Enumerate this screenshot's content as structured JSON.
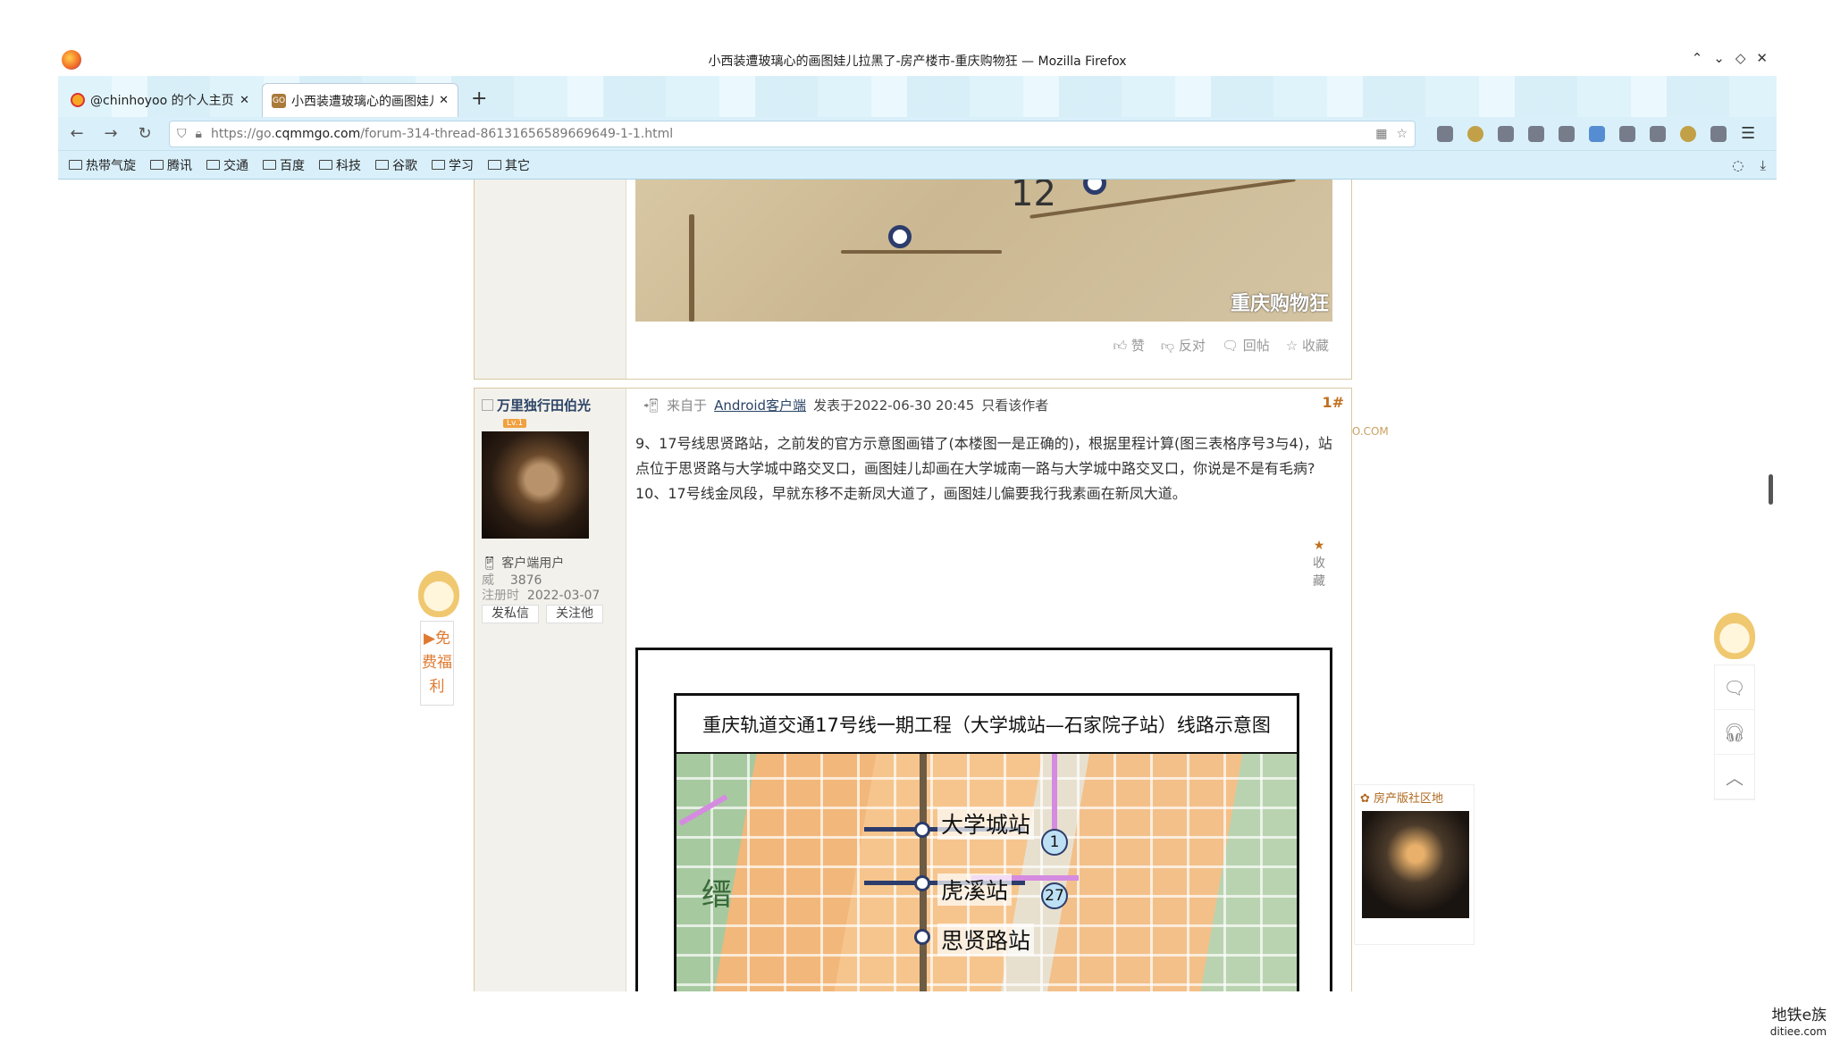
{
  "window": {
    "title": "小西装遭玻璃心的画图娃儿拉黑了-房产楼市-重庆购物狂 — Mozilla Firefox",
    "controls": [
      "⌃",
      "⌄",
      "◇",
      "✕"
    ]
  },
  "tabs": [
    {
      "title": "@chinhoyoo 的个人主页 - 微",
      "close": "✕"
    },
    {
      "title": "小西装遭玻璃心的画图娃儿拉黑了",
      "close": "✕",
      "favicon_text": "GO"
    }
  ],
  "new_tab": "+",
  "nav": {
    "back": "←",
    "forward": "→",
    "reload": "↻",
    "url_prefix": "https://go.",
    "url_domain": "cqmmgo.com",
    "url_path": "/forum-314-thread-86131656589669649-1-1.html"
  },
  "bookmarks": [
    "热带气旋",
    "腾讯",
    "交通",
    "百度",
    "科技",
    "谷歌",
    "学习",
    "其它"
  ],
  "post1": {
    "map_number": "12",
    "watermark": "重庆购物狂",
    "actions": [
      "赞",
      "反对",
      "回帖",
      "收藏"
    ]
  },
  "site_mark": "CQMMGO.COM",
  "post2": {
    "author": "万里独行田伯光",
    "level_badge": "Lv.1",
    "user_type": "客户端用户",
    "stat_wei_label": "威",
    "stat_wei_value": "3876",
    "stat_reg_label": "注册时",
    "stat_reg_value": "2022-03-07",
    "btn_msg": "发私信",
    "btn_follow": "关注他",
    "meta_from": "来自于",
    "meta_client": "Android客户端",
    "meta_posted": "发表于2022-06-30 20:45",
    "meta_only": "只看该作者",
    "floor": "1#",
    "content_line1": "9、17号线思贤路站，之前发的官方示意图画错了(本楼图一是正确的)，根据里程计算(图三表格序号3与4)，站点位于思贤路与大学城中路交叉口，画图娃儿却画在大学城南一路与大学城中路交叉口，你说是不是有毛病?",
    "content_line2": "10、17号线金凤段，早就东移不走新凤大道了，画图娃儿偏要我行我素画在新凤大道。",
    "image_title": "重庆轨道交通17号线一期工程（大学城站—石家院子站）线路示意图",
    "stations": [
      "大学城站",
      "虎溪站",
      "思贤路站"
    ],
    "line_circles": [
      "1",
      "27"
    ],
    "map_char": "缙",
    "fav_label": "收藏"
  },
  "left_float": {
    "text": "▶免费福利"
  },
  "community": {
    "title": "房产版社区地"
  },
  "corner_mark": {
    "line1": "地铁e族",
    "line2": "ditiee.com"
  }
}
